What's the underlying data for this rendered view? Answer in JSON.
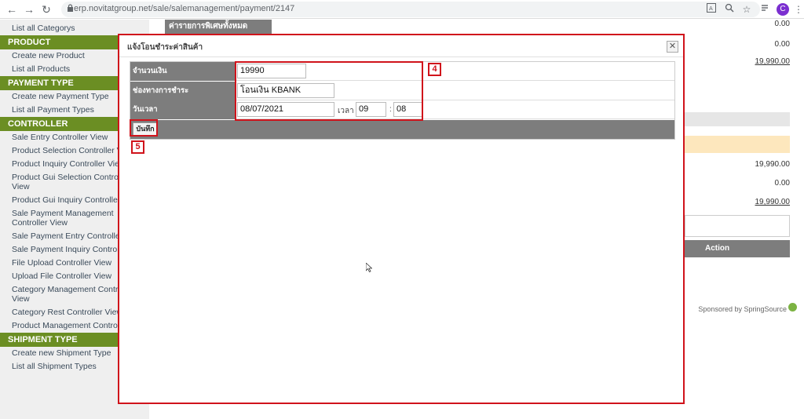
{
  "browser": {
    "back": "←",
    "forward": "→",
    "reload": "↻",
    "url": "erp.novitatgroup.net/sale/salemanagement/payment/2147",
    "avatar_letter": "C"
  },
  "sidebar": {
    "top_item": "List all Categorys",
    "sections": [
      {
        "title": "PRODUCT",
        "items": [
          "Create new Product",
          "List all Products"
        ]
      },
      {
        "title": "PAYMENT TYPE",
        "items": [
          "Create new Payment Type",
          "List all Payment Types"
        ]
      },
      {
        "title": "CONTROLLER",
        "items": [
          "Sale Entry Controller View",
          "Product Selection Controller View",
          "Product Inquiry Controller View",
          "Product Gui Selection Controller View",
          "Product Gui Inquiry Controller View",
          "Sale Payment Management Controller View",
          "Sale Payment Entry Controller View",
          "Sale Payment Inquiry Controller View",
          "File Upload Controller View",
          "Upload File Controller View",
          "Category Management Controller View",
          "Category Rest Controller View",
          "Product Management Controller View"
        ]
      },
      {
        "title": "SHIPMENT TYPE",
        "items": [
          "Create new Shipment Type",
          "List all Shipment Types"
        ]
      }
    ]
  },
  "background": {
    "header_label": "ค่ารายการพิเศษทั้งหมด",
    "values_top": [
      "0.00",
      "0.00",
      "19,990.00"
    ],
    "values_mid": [
      "19,990.00",
      "0.00",
      "19,990.00"
    ],
    "action_label": "Action",
    "sponsor": "Sponsored by SpringSource"
  },
  "modal": {
    "title": "แจ้งโอนชำระค่าสินค้า",
    "close": "✕",
    "amount_label": "จำนวนเงิน",
    "amount_value": "19990",
    "channel_label": "ช่องทางการชำระ",
    "channel_value": "โอนเงิน KBANK",
    "date_label": "วันเวลา",
    "date_value": "08/07/2021",
    "time_label": "เวลา",
    "hour": "09",
    "sep": ":",
    "minute": "08",
    "save_label": "บันทึก"
  },
  "annotations": {
    "box4": "4",
    "box5": "5"
  },
  "colors": {
    "annotation": "#d0131b",
    "sidebar_header": "#6b8e23",
    "label_bg": "#7d7d7d"
  }
}
